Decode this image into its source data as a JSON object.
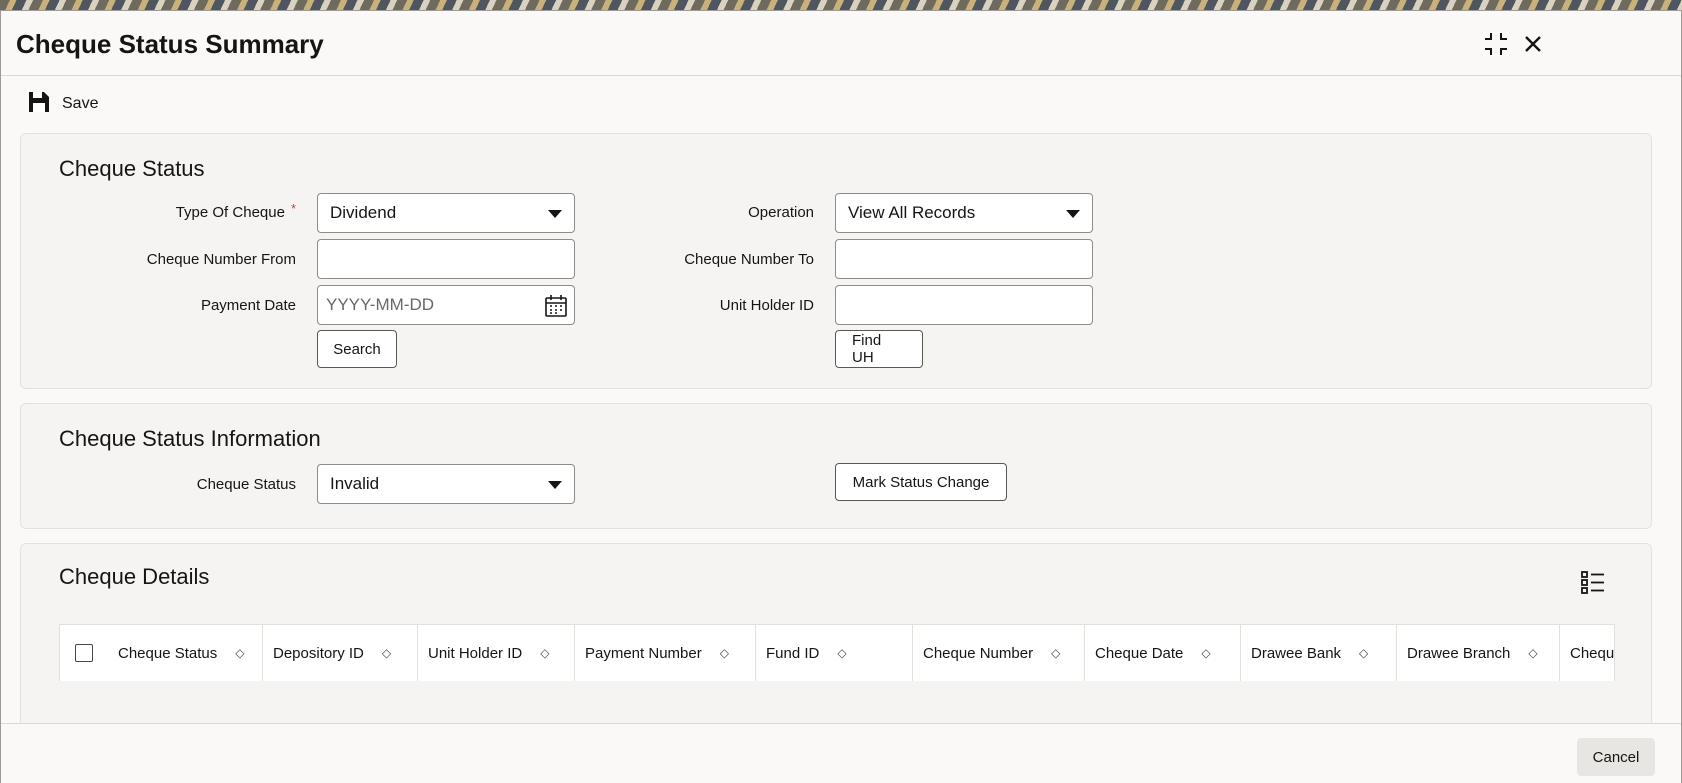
{
  "window": {
    "title": "Cheque Status Summary"
  },
  "toolbar": {
    "save_label": "Save"
  },
  "cheque_status": {
    "heading": "Cheque Status",
    "type_of_cheque_label": "Type Of Cheque",
    "required_mark": "*",
    "type_of_cheque_value": "Dividend",
    "operation_label": "Operation",
    "operation_value": "View All Records",
    "cheque_number_from_label": "Cheque Number From",
    "cheque_number_from_value": "",
    "cheque_number_to_label": "Cheque Number To",
    "cheque_number_to_value": "",
    "payment_date_label": "Payment Date",
    "payment_date_placeholder": "YYYY-MM-DD",
    "unit_holder_id_label": "Unit Holder ID",
    "unit_holder_id_value": "",
    "search_label": "Search",
    "find_uh_label": "Find UH"
  },
  "cheque_status_info": {
    "heading": "Cheque Status Information",
    "cheque_status_label": "Cheque Status",
    "cheque_status_value": "Invalid",
    "mark_status_change_label": "Mark Status Change"
  },
  "cheque_details": {
    "heading": "Cheque Details",
    "columns": [
      "Cheque Status",
      "Depository ID",
      "Unit Holder ID",
      "Payment Number",
      "Fund ID",
      "Cheque Number",
      "Cheque Date",
      "Drawee Bank",
      "Drawee Branch",
      "Chequ"
    ]
  },
  "footer": {
    "cancel_label": "Cancel"
  },
  "colors": {
    "accent_required": "#c74634",
    "background": "#fbf9f8",
    "panel": "#f5f4f2"
  }
}
